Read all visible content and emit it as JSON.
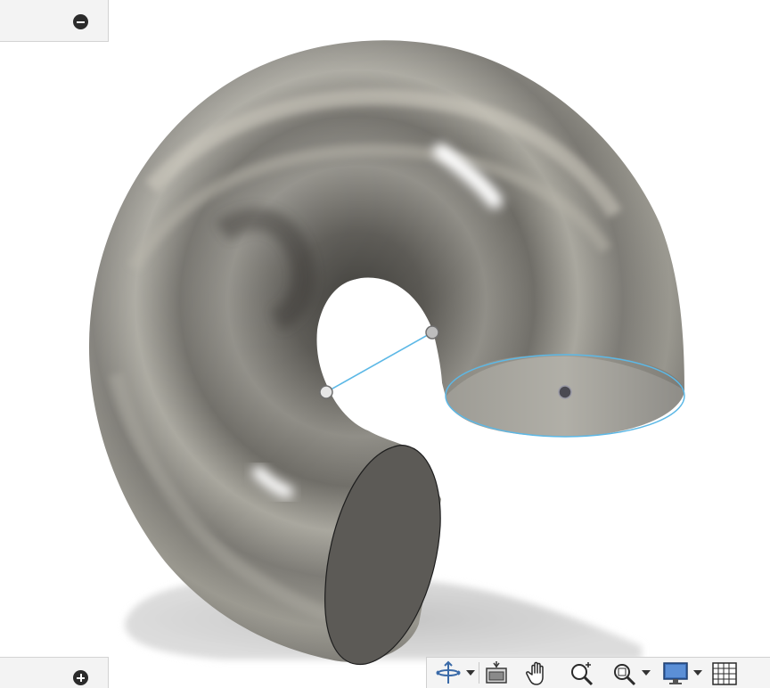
{
  "window": {
    "title": ""
  },
  "panels": {
    "top_collapse_icon": "minus-circle-icon",
    "bottom_expand_icon": "plus-circle-icon"
  },
  "navigation_toolbar": {
    "tools": [
      {
        "name": "orbit",
        "icon": "orbit-icon",
        "has_menu": true
      },
      {
        "name": "look-at",
        "icon": "look-at-icon",
        "has_menu": false
      },
      {
        "name": "pan",
        "icon": "pan-hand-icon",
        "has_menu": false
      },
      {
        "name": "zoom",
        "icon": "zoom-icon",
        "has_menu": false
      },
      {
        "name": "fit",
        "icon": "zoom-window-icon",
        "has_menu": true
      },
      {
        "name": "display-settings",
        "icon": "display-monitor-icon",
        "has_menu": true
      },
      {
        "name": "grid-settings",
        "icon": "grid-icon",
        "has_menu": false
      }
    ]
  },
  "model": {
    "body": "torus-section",
    "material_color": "#8a8880",
    "end_face_color": "#5c5a56",
    "selection_color": "#5cb8e6",
    "shadow_color": "#c9c9c9"
  }
}
